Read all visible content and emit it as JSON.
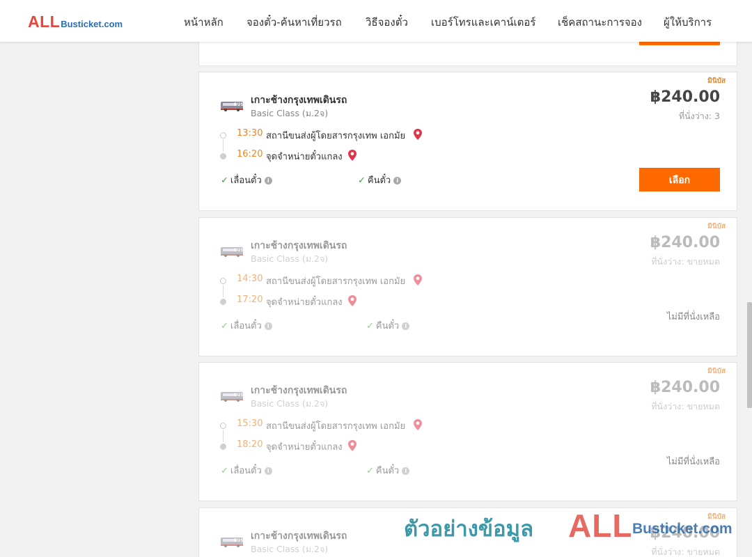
{
  "header": {
    "logo_all": "ALL",
    "logo_rest": "Busticket.com",
    "nav": [
      "หน้าหลัก",
      "จองตั๋ว-ค้นหาเที่ยวรถ",
      "วิธีจองตั๋ว",
      "เบอร์โทรและเคาน์เตอร์",
      "เช็คสถานะการจอง",
      "ผู้ให้บริการ"
    ]
  },
  "colors": {
    "accent": "#ff6a00",
    "time": "#e8872a",
    "check": "#3aa53a",
    "pin": "#e0344a"
  },
  "trips": [
    {
      "tag": "มินิบัส",
      "operator": "เกาะช้างกรุงเทพเดินรถ",
      "class": "Basic Class (ม.2จ)",
      "price": "฿240.00",
      "seats": "ที่นั่งว่าง: 3",
      "depart_time": "13:30",
      "depart_place": "สถานีขนส่งผู้โดยสารกรุงเทพ เอกมัย",
      "arrive_time": "16:20",
      "arrive_place": "จุดจำหน่ายตั๋วแกลง",
      "feature1": "เลื่อนตั๋ว",
      "feature2": "คืนตั๋ว",
      "action": "เลือก"
    },
    {
      "tag": "มินิบัส",
      "operator": "เกาะช้างกรุงเทพเดินรถ",
      "class": "Basic Class (ม.2จ)",
      "price": "฿240.00",
      "seats": "ที่นั่งว่าง: ขายหมด",
      "depart_time": "14:30",
      "depart_place": "สถานีขนส่งผู้โดยสารกรุงเทพ เอกมัย",
      "arrive_time": "17:20",
      "arrive_place": "จุดจำหน่ายตั๋วแกลง",
      "feature1": "เลื่อนตั๋ว",
      "feature2": "คืนตั๋ว",
      "status": "ไม่มีที่นั่งเหลือ"
    },
    {
      "tag": "มินิบัส",
      "operator": "เกาะช้างกรุงเทพเดินรถ",
      "class": "Basic Class (ม.2จ)",
      "price": "฿240.00",
      "seats": "ที่นั่งว่าง: ขายหมด",
      "depart_time": "15:30",
      "depart_place": "สถานีขนส่งผู้โดยสารกรุงเทพ เอกมัย",
      "arrive_time": "18:20",
      "arrive_place": "จุดจำหน่ายตั๋วแกลง",
      "feature1": "เลื่อนตั๋ว",
      "feature2": "คืนตั๋ว",
      "status": "ไม่มีที่นั่งเหลือ"
    },
    {
      "tag": "มินิบัส",
      "operator": "เกาะช้างกรุงเทพเดินรถ",
      "class": "Basic Class (ม.2จ)",
      "price": "฿240.00",
      "seats": "ที่นั่งว่าง: ขายหมด"
    }
  ],
  "watermark": {
    "thai": "ตัวอย่างข้อมูล",
    "all": "ALL",
    "rest": "Busticket.com"
  }
}
